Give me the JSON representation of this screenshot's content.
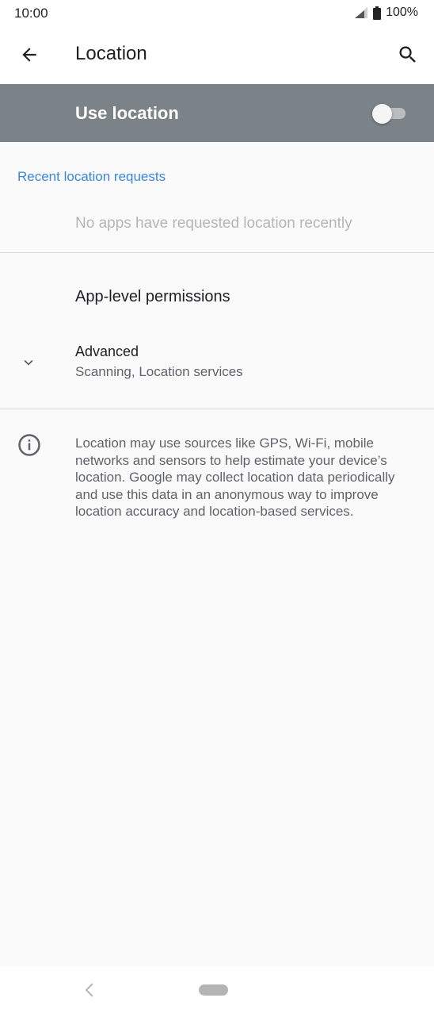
{
  "status_bar": {
    "time": "10:00",
    "battery": "100%",
    "icons": [
      "signal-icon",
      "battery-icon"
    ]
  },
  "app_bar": {
    "title": "Location",
    "back_icon": "arrow-back-icon",
    "search_icon": "search-icon"
  },
  "use_location": {
    "label": "Use location",
    "enabled": false
  },
  "recent_requests": {
    "header": "Recent location requests",
    "empty_message": "No apps have requested location recently"
  },
  "items": {
    "app_permissions": "App-level permissions",
    "advanced_title": "Advanced",
    "advanced_summary": "Scanning, Location services"
  },
  "info": {
    "icon": "info-icon",
    "text": "Location may use sources like GPS, Wi-Fi, mobile networks and sensors to help estimate your device’s location. Google may collect location data periodically and use this data in an anonymous way to improve location accuracy and location-based services."
  },
  "colors": {
    "accent": "#3b86de",
    "toolbar_gray": "#7b8388",
    "background": "#fafafa"
  }
}
